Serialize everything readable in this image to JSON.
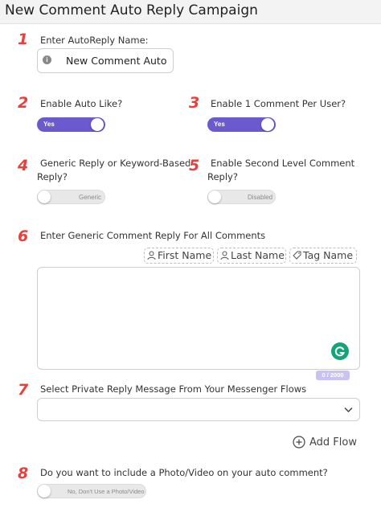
{
  "header": {
    "title": "New Comment Auto Reply Campaign"
  },
  "steps": [
    "1",
    "2",
    "3",
    "4",
    "5",
    "6",
    "7",
    "8"
  ],
  "autoreply_name": {
    "label": "Enter AutoReply Name:",
    "value": "New Comment Auto Re"
  },
  "auto_like": {
    "label": "Enable Auto Like?",
    "state": "Yes"
  },
  "one_comment": {
    "label": "Enable 1 Comment Per User?",
    "state": "Yes"
  },
  "reply_type": {
    "label_line1": "Generic Reply or Keyword-Based",
    "label_line2": "Reply?",
    "state": "Generic"
  },
  "second_level": {
    "label_line1": "Enable Second Level Comment",
    "label_line2": "Reply?",
    "state": "Disabled"
  },
  "generic_reply": {
    "label": "Enter Generic Comment Reply For All Comments",
    "tags": [
      "First Name",
      "Last Name",
      "Tag Name"
    ],
    "counter": "0 / 2000"
  },
  "private_reply": {
    "label": "Select Private Reply Message From Your Messenger Flows",
    "selected": ""
  },
  "add_flow": {
    "label": "Add Flow"
  },
  "media": {
    "label": "Do you want to include a Photo/Video on your auto comment?",
    "state": "No, Don't Use a Photo/Video"
  },
  "colors": {
    "accent": "#6a5acd",
    "step": "#e8413c",
    "grammarly": "#15a47a"
  }
}
